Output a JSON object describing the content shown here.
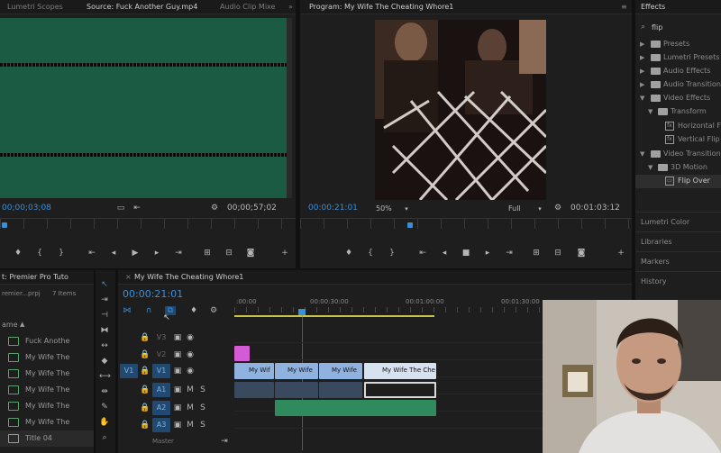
{
  "source_panel": {
    "tabs": [
      "Lumetri Scopes",
      "Source: Fuck Another Guy.mp4",
      "Audio Clip Mixe"
    ],
    "more": "»",
    "timecode_in": "00;00;03;08",
    "timecode_out": "00;00;57;02",
    "bg_color": "#1b5a43"
  },
  "program_panel": {
    "tab": "Program: My Wife The Cheating Whore1",
    "menu": "≡",
    "timecode_in": "00:00:21:01",
    "zoom": "50%",
    "quality": "Full",
    "timecode_out": "00:01:03:12"
  },
  "effects_panel": {
    "tab": "Effects",
    "search_value": "flip",
    "items": [
      {
        "label": "Presets",
        "depth": 0,
        "kind": "folder",
        "open": false
      },
      {
        "label": "Lumetri Presets",
        "depth": 0,
        "kind": "folder",
        "open": false
      },
      {
        "label": "Audio Effects",
        "depth": 0,
        "kind": "folder",
        "open": false
      },
      {
        "label": "Audio Transitions",
        "depth": 0,
        "kind": "folder",
        "open": false
      },
      {
        "label": "Video Effects",
        "depth": 0,
        "kind": "folder",
        "open": true
      },
      {
        "label": "Transform",
        "depth": 1,
        "kind": "folder",
        "open": true
      },
      {
        "label": "Horizontal Fl",
        "depth": 2,
        "kind": "effect"
      },
      {
        "label": "Vertical Flip",
        "depth": 2,
        "kind": "effect"
      },
      {
        "label": "Video Transitions",
        "depth": 0,
        "kind": "folder",
        "open": true
      },
      {
        "label": "3D Motion",
        "depth": 1,
        "kind": "folder",
        "open": true
      },
      {
        "label": "Flip Over",
        "depth": 2,
        "kind": "effect",
        "selected": true
      }
    ],
    "sections": [
      "Lumetri Color",
      "Libraries",
      "Markers",
      "History"
    ]
  },
  "project_panel": {
    "tab": "t: Premier Pro Tuto",
    "file": "remier...prpj",
    "count": "7 Items",
    "name_header": "ame",
    "items": [
      "Fuck Anothe",
      "My Wife The",
      "My Wife The",
      "My Wife The",
      "My Wife The",
      "My Wife The",
      "Title 04"
    ]
  },
  "timeline_panel": {
    "tab": "My Wife The Cheating Whore1",
    "timecode": "00:00:21:01",
    "ruler": [
      ":00:00",
      "00:00:30:00",
      "00:01:00:00",
      "00:01:30:00"
    ],
    "tracks": [
      {
        "name": "V3",
        "eye": "◉"
      },
      {
        "name": "V2",
        "eye": "◉"
      },
      {
        "name": "V1",
        "eye": "◉",
        "source": "V1"
      },
      {
        "name": "A1",
        "m": "M",
        "s": "S",
        "source": "A1"
      },
      {
        "name": "A2",
        "m": "M",
        "s": "S"
      },
      {
        "name": "A3",
        "m": "M",
        "s": "S"
      }
    ],
    "master": "Master",
    "clips_v1": [
      "My Wif",
      "My Wife",
      "My Wife",
      "My Wife The Che"
    ]
  },
  "colors": {
    "accent_blue": "#3a8fd9",
    "clip_video": "#8fb2e0",
    "clip_audio": "#2f8a5e",
    "clip_pink": "#d45ad6",
    "work_area": "#c9c34a"
  }
}
